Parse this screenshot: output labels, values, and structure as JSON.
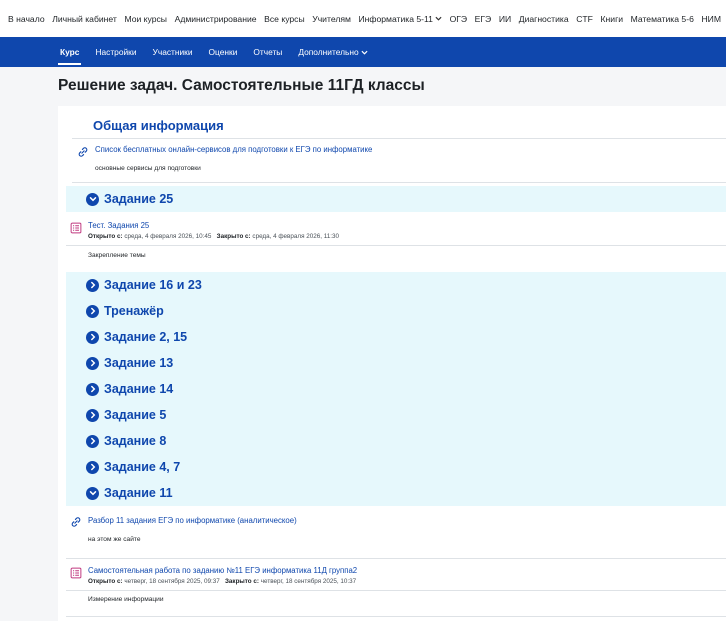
{
  "top_nav": [
    {
      "label": "В начало"
    },
    {
      "label": "Личный кабинет"
    },
    {
      "label": "Мои курсы"
    },
    {
      "label": "Администрирование"
    },
    {
      "label": "Все курсы"
    },
    {
      "label": "Учителям"
    },
    {
      "label": "Информатика 5-11",
      "dropdown": true
    },
    {
      "label": "ОГЭ"
    },
    {
      "label": "ЕГЭ"
    },
    {
      "label": "ИИ"
    },
    {
      "label": "Диагностика"
    },
    {
      "label": "CTF"
    },
    {
      "label": "Книги"
    },
    {
      "label": "Математика 5-6"
    },
    {
      "label": "НИМ"
    }
  ],
  "course_nav": [
    {
      "label": "Курс",
      "active": true
    },
    {
      "label": "Настройки"
    },
    {
      "label": "Участники"
    },
    {
      "label": "Оценки"
    },
    {
      "label": "Отчеты"
    },
    {
      "label": "Дополнительно",
      "dropdown": true
    }
  ],
  "page_title": "Решение задач. Самостоятельные 11ГД классы",
  "general": {
    "title": "Общая информация",
    "link": "Список бесплатных онлайн-сервисов для подготовки к ЕГЭ по информатике",
    "desc": "основные сервисы для подготовки"
  },
  "section_25": {
    "title": "Задание 25",
    "expanded": true
  },
  "quiz_25": {
    "title": "Тест. Задания 25",
    "open_label": "Открыто с:",
    "open_value": "среда, 4 февраля 2026, 10:45",
    "close_label": "Закрыто с:",
    "close_value": "среда, 4 февраля 2026, 11:30",
    "desc": "Закрепление темы"
  },
  "collapsed_sections": [
    {
      "title": "Задание 16 и 23"
    },
    {
      "title": "Тренажёр"
    },
    {
      "title": "Задание 2, 15"
    },
    {
      "title": "Задание 13"
    },
    {
      "title": "Задание 14"
    },
    {
      "title": "Задание 5"
    },
    {
      "title": "Задание 8"
    },
    {
      "title": "Задание 4, 7"
    }
  ],
  "section_11": {
    "title": "Задание 11",
    "expanded": true
  },
  "url_11": {
    "title": "Разбор 11 задания ЕГЭ по информатике (аналитическое)",
    "desc": "на этом же сайте"
  },
  "quiz_11": {
    "title": "Самостоятельная работа по заданию №11 ЕГЭ информатика 11Д группа2",
    "open_label": "Открыто с:",
    "open_value": "четверг, 18 сентября 2025, 09:37",
    "close_label": "Закрыто с:",
    "close_value": "четверг, 18 сентября 2025, 10:37",
    "desc": "Измерение информации"
  },
  "colors": {
    "brand": "#0f47ad",
    "section_bg": "#e6f8fc",
    "quiz_icon": "#c0377f",
    "link_icon": "#0f47ad"
  }
}
